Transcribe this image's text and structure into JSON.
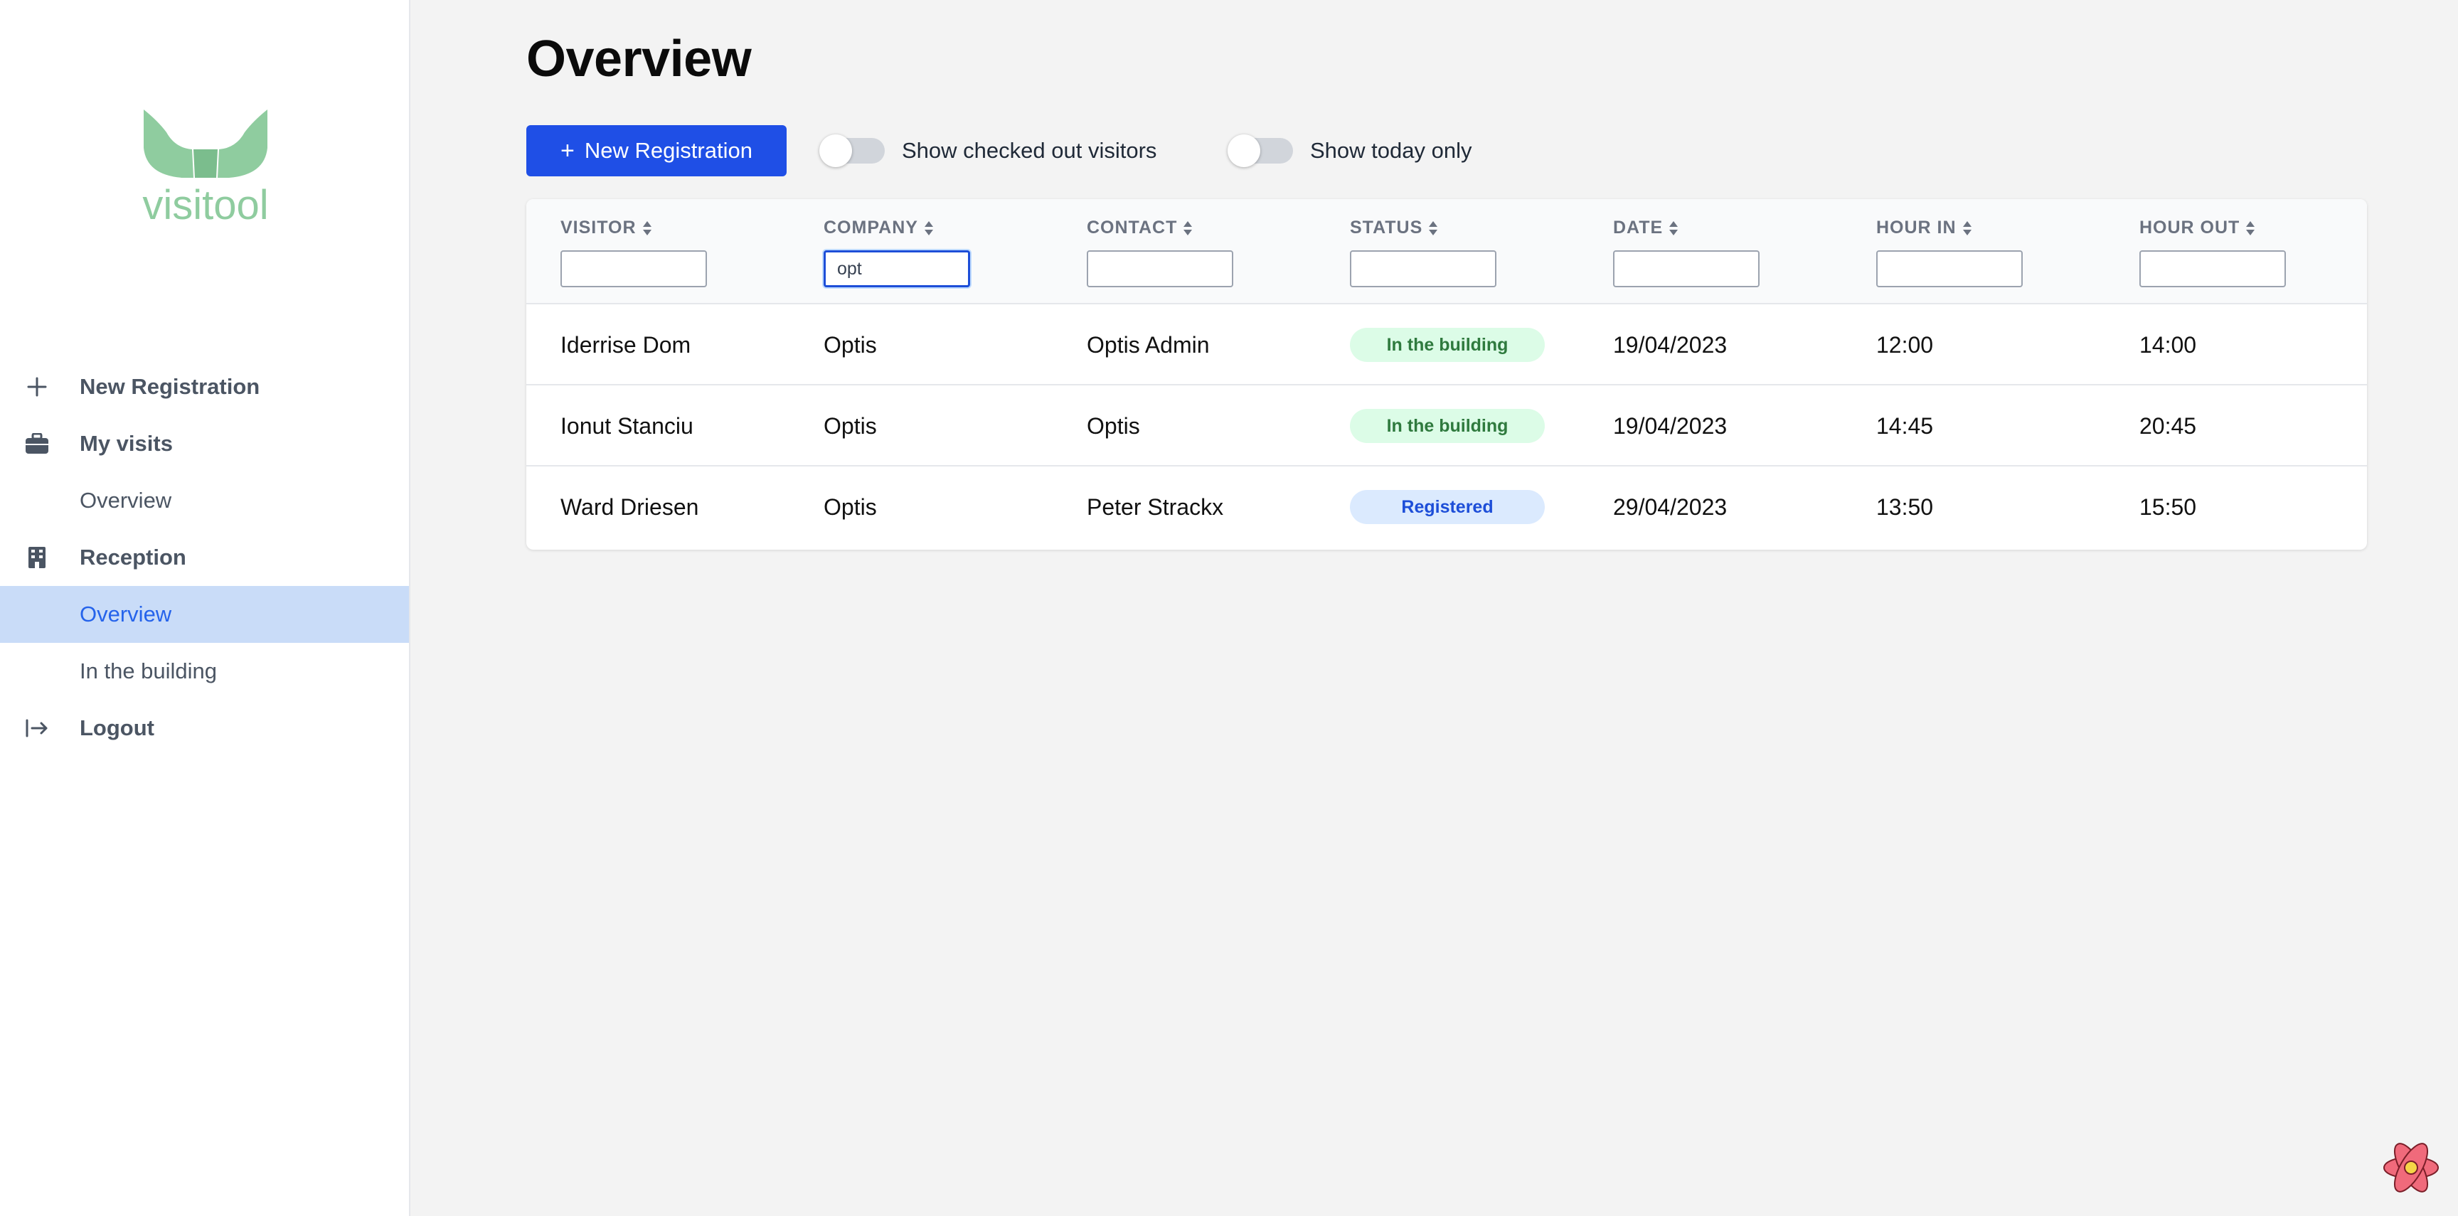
{
  "brand": {
    "logo_text": "visitool",
    "logo_color": "#8fcc9f"
  },
  "sidebar": {
    "items": [
      {
        "label": "New Registration",
        "icon": "plus-icon",
        "type": "section"
      },
      {
        "label": "My visits",
        "icon": "briefcase-icon",
        "type": "section"
      },
      {
        "label": "Overview",
        "type": "sub"
      },
      {
        "label": "Reception",
        "icon": "building-icon",
        "type": "section"
      },
      {
        "label": "Overview",
        "type": "sub",
        "active": true
      },
      {
        "label": "In the building",
        "type": "sub"
      },
      {
        "label": "Logout",
        "icon": "logout-icon",
        "type": "section"
      }
    ]
  },
  "main": {
    "title": "Overview",
    "toolbar": {
      "new_registration_label": "New Registration",
      "toggle_checked_out_label": "Show checked out visitors",
      "toggle_checked_out_on": false,
      "toggle_today_label": "Show today only",
      "toggle_today_on": false
    },
    "table": {
      "columns": [
        {
          "label": "VISITOR",
          "filter": ""
        },
        {
          "label": "COMPANY",
          "filter": "opt"
        },
        {
          "label": "CONTACT",
          "filter": ""
        },
        {
          "label": "STATUS",
          "filter": ""
        },
        {
          "label": "DATE",
          "filter": ""
        },
        {
          "label": "HOUR IN",
          "filter": ""
        },
        {
          "label": "HOUR OUT",
          "filter": ""
        }
      ],
      "rows": [
        {
          "visitor": "Iderrise Dom",
          "company": "Optis",
          "contact": "Optis Admin",
          "status": "In the building",
          "date": "19/04/2023",
          "hour_in": "12:00",
          "hour_out": "14:00"
        },
        {
          "visitor": "Ionut Stanciu",
          "company": "Optis",
          "contact": "Optis",
          "status": "In the building",
          "date": "19/04/2023",
          "hour_in": "14:45",
          "hour_out": "20:45"
        },
        {
          "visitor": "Ward Driesen",
          "company": "Optis",
          "contact": "Peter Strackx",
          "status": "Registered",
          "date": "29/04/2023",
          "hour_in": "13:50",
          "hour_out": "15:50"
        }
      ]
    }
  },
  "colors": {
    "primary": "#1f4fe6",
    "active_nav_bg": "#c9dcf8",
    "status_in_bg": "#dcfce7",
    "status_in_text": "#2f7a3e",
    "status_registered_bg": "#dbeafe",
    "status_registered_text": "#1d4ed8"
  },
  "devtools_icon": "react-devtools-icon"
}
